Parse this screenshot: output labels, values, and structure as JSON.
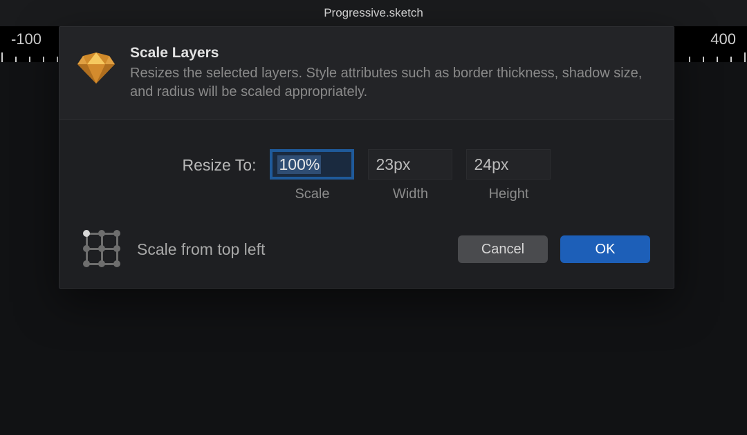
{
  "window": {
    "title": "Progressive.sketch"
  },
  "ruler": {
    "left_label": "-100",
    "right_label": "400"
  },
  "dialog": {
    "title": "Scale Layers",
    "description": "Resizes the selected layers. Style attributes such as border thickness, shadow size, and radius will be scaled appropriately.",
    "resize_label": "Resize To:",
    "fields": {
      "scale": {
        "value": "100%",
        "label": "Scale"
      },
      "width": {
        "value": "23px",
        "label": "Width"
      },
      "height": {
        "value": "24px",
        "label": "Height"
      }
    },
    "anchor_label": "Scale from top left",
    "buttons": {
      "cancel": "Cancel",
      "ok": "OK"
    }
  }
}
